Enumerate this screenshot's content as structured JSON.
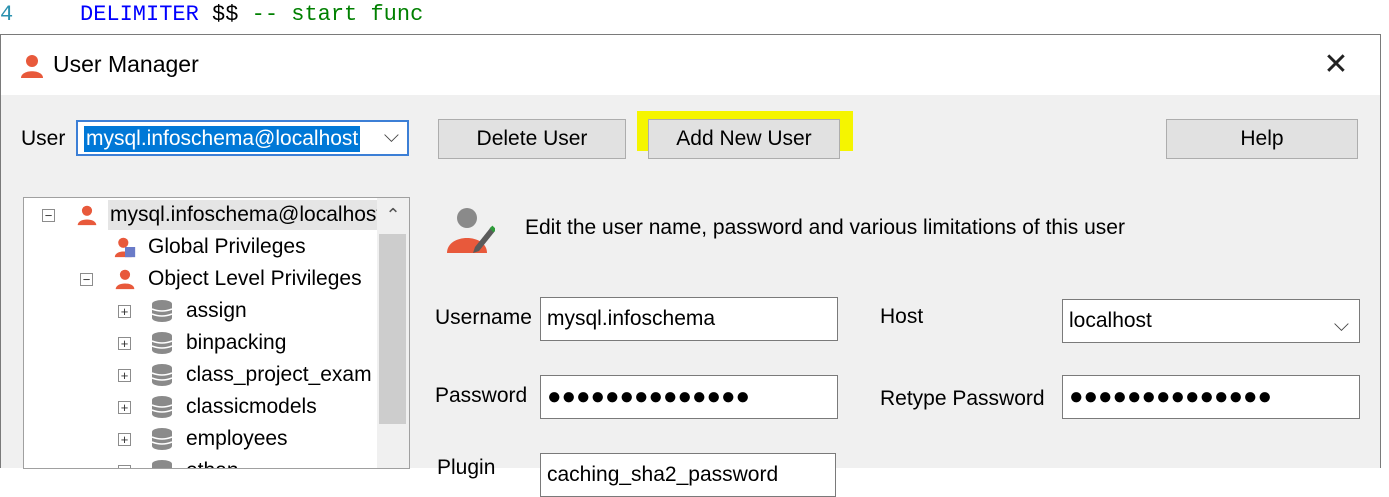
{
  "editor": {
    "line_number": "4",
    "keyword": "DELIMITER",
    "rest": " $$ ",
    "comment": "-- start func"
  },
  "window": {
    "title": "User Manager",
    "close_glyph": "✕"
  },
  "toolbar": {
    "user_label": "User",
    "user_value": "mysql.infoschema@localhost",
    "delete_label": "Delete User",
    "add_label": "Add New User",
    "help_label": "Help",
    "highlight_color": "#f5f500"
  },
  "tree": {
    "root": "mysql.infoschema@localhost",
    "global": "Global Privileges",
    "object_level": "Object Level Privileges",
    "databases": [
      "assign",
      "binpacking",
      "class_project_exam",
      "classicmodels",
      "employees",
      "ethan"
    ]
  },
  "editor_panel": {
    "description": "Edit the user name, password and various limitations of this user",
    "username_label": "Username",
    "username_value": "mysql.infoschema",
    "host_label": "Host",
    "host_value": "localhost",
    "password_label": "Password",
    "password_value": "●●●●●●●●●●●●●●",
    "retype_label": "Retype Password",
    "retype_value": "●●●●●●●●●●●●●●",
    "plugin_label": "Plugin",
    "plugin_value": "caching_sha2_password"
  },
  "icons": {
    "user": "user-icon",
    "edit_user": "edit-user-icon",
    "database": "database-icon",
    "global_privileges": "global-privileges-icon"
  },
  "colors": {
    "selection": "#0078d7",
    "user_icon": "#e8593b"
  }
}
